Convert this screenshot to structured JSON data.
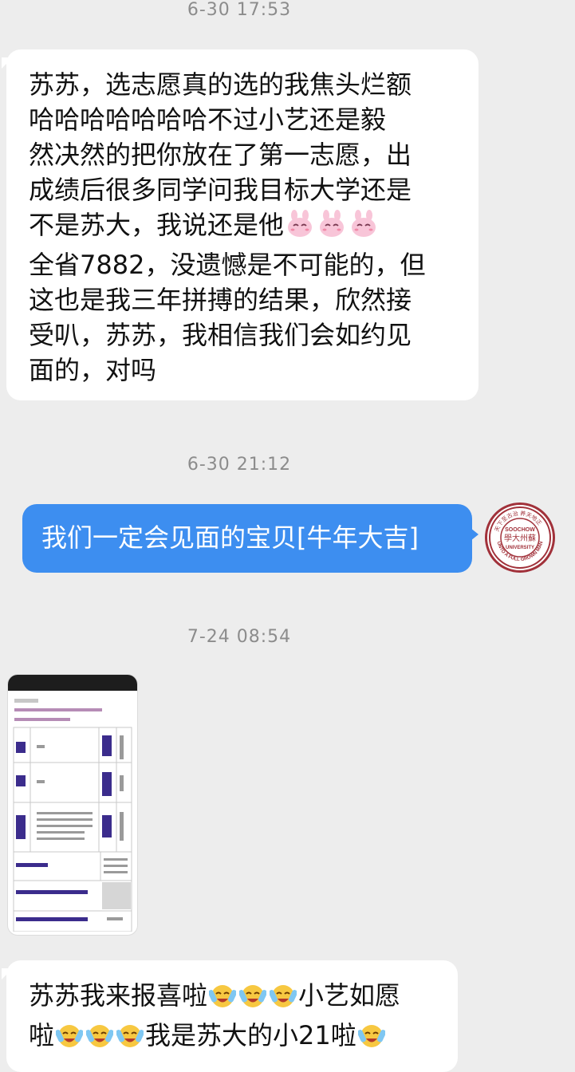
{
  "timestamps": [
    "6-30 17:53",
    "6-30 21:12",
    "7-24 08:54"
  ],
  "msg1_lines": [
    "苏苏，选志愿真的选的我焦头烂额",
    "哈哈哈哈哈哈哈不过小艺还是毅",
    "然决然的把你放在了第一志愿，出",
    "成绩后很多同学问我目标大学还是",
    "不是苏大，我说还是他",
    "全省7882，没遗憾是不可能的，但",
    "这也是我三年拼搏的结果，欣然接",
    "受叭，苏苏，我相信我们会如约见",
    "面的，对吗"
  ],
  "msg2": "我们一定会见面的宝贝[牛年大吉]",
  "avatar": {
    "ring_top": "天下至古治 养天地正",
    "ring_bottom": "UNTO A FULL GROWN MAN",
    "center_top": "SOOCHOW",
    "center_mid": "學大州蘇",
    "center_bottom": "UNIVERSITY"
  },
  "msg4": {
    "line1_a": "苏苏我来报喜啦",
    "line1_b": "小艺如愿",
    "line2_a": "啦",
    "line2_b": "我是苏大的小21啦"
  },
  "colors": {
    "background": "#ededed",
    "bubble_in": "#ffffff",
    "bubble_out": "#3d8ef0",
    "avatar_ring": "#a1313a"
  }
}
